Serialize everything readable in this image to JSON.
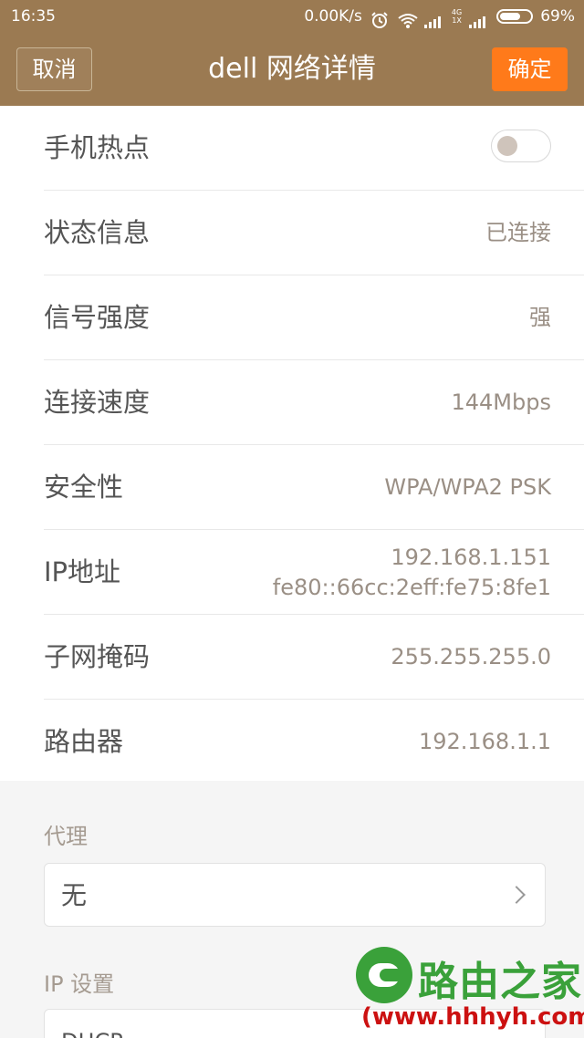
{
  "status_bar": {
    "time": "16:35",
    "speed": "0.00K/s",
    "network_type_top": "4G",
    "network_type_bottom": "1X",
    "battery": "69%",
    "battery_level": 0.69,
    "icons": [
      "alarm-icon",
      "wifi-icon",
      "signal-icon",
      "signal-icon",
      "battery-icon"
    ]
  },
  "header": {
    "cancel_label": "取消",
    "title": "dell  网络详情",
    "confirm_label": "确定",
    "background_color": "#9b7a52",
    "confirm_color": "#ff7a1a"
  },
  "details": {
    "hotspot_label": "手机热点",
    "hotspot_on": false,
    "status_label": "状态信息",
    "status_value": "已连接",
    "signal_label": "信号强度",
    "signal_value": "强",
    "speed_label": "连接速度",
    "speed_value": "144Mbps",
    "security_label": "安全性",
    "security_value": "WPA/WPA2 PSK",
    "ip_label": "IP地址",
    "ip_v4": "192.168.1.151",
    "ip_v6": "fe80::66cc:2eff:fe75:8fe1",
    "subnet_label": "子网掩码",
    "subnet_value": "255.255.255.0",
    "router_label": "路由器",
    "router_value": "192.168.1.1"
  },
  "proxy": {
    "label": "代理",
    "value": "无"
  },
  "ip_settings": {
    "label": "IP 设置",
    "value": "DHCP"
  },
  "watermark": {
    "title": "路由之家",
    "url": "(www.hhhyh.com"
  }
}
